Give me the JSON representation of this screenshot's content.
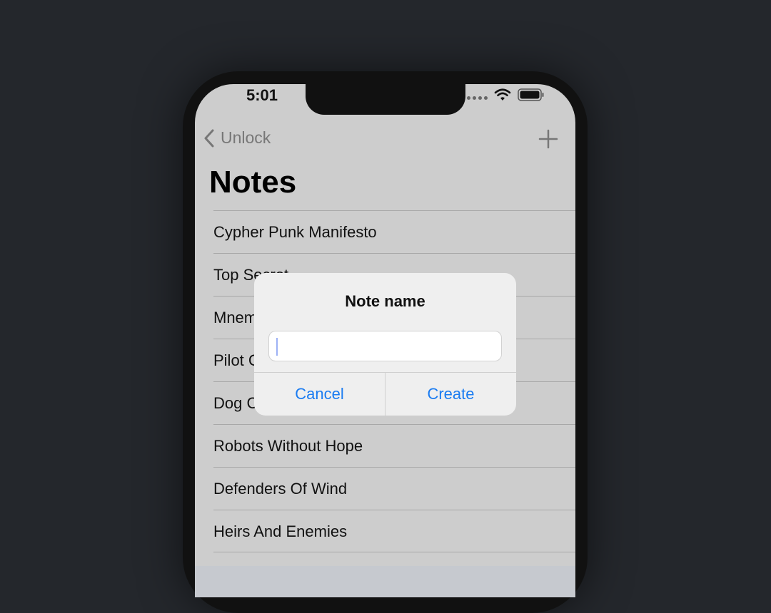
{
  "status_bar": {
    "time": "5:01"
  },
  "nav": {
    "back_label": "Unlock"
  },
  "page": {
    "title": "Notes"
  },
  "notes": [
    "Cypher Punk Manifesto",
    "Top Secret",
    "Mnemonic",
    "Pilot Codes",
    "Dog Commands",
    "Robots Without Hope",
    "Defenders Of Wind",
    "Heirs And Enemies"
  ],
  "alert": {
    "title": "Note name",
    "input_value": "",
    "cancel_label": "Cancel",
    "create_label": "Create"
  },
  "colors": {
    "accent": "#1b7cf1",
    "screen_bg": "#cdcdcd",
    "desktop_bg": "#24272c"
  }
}
